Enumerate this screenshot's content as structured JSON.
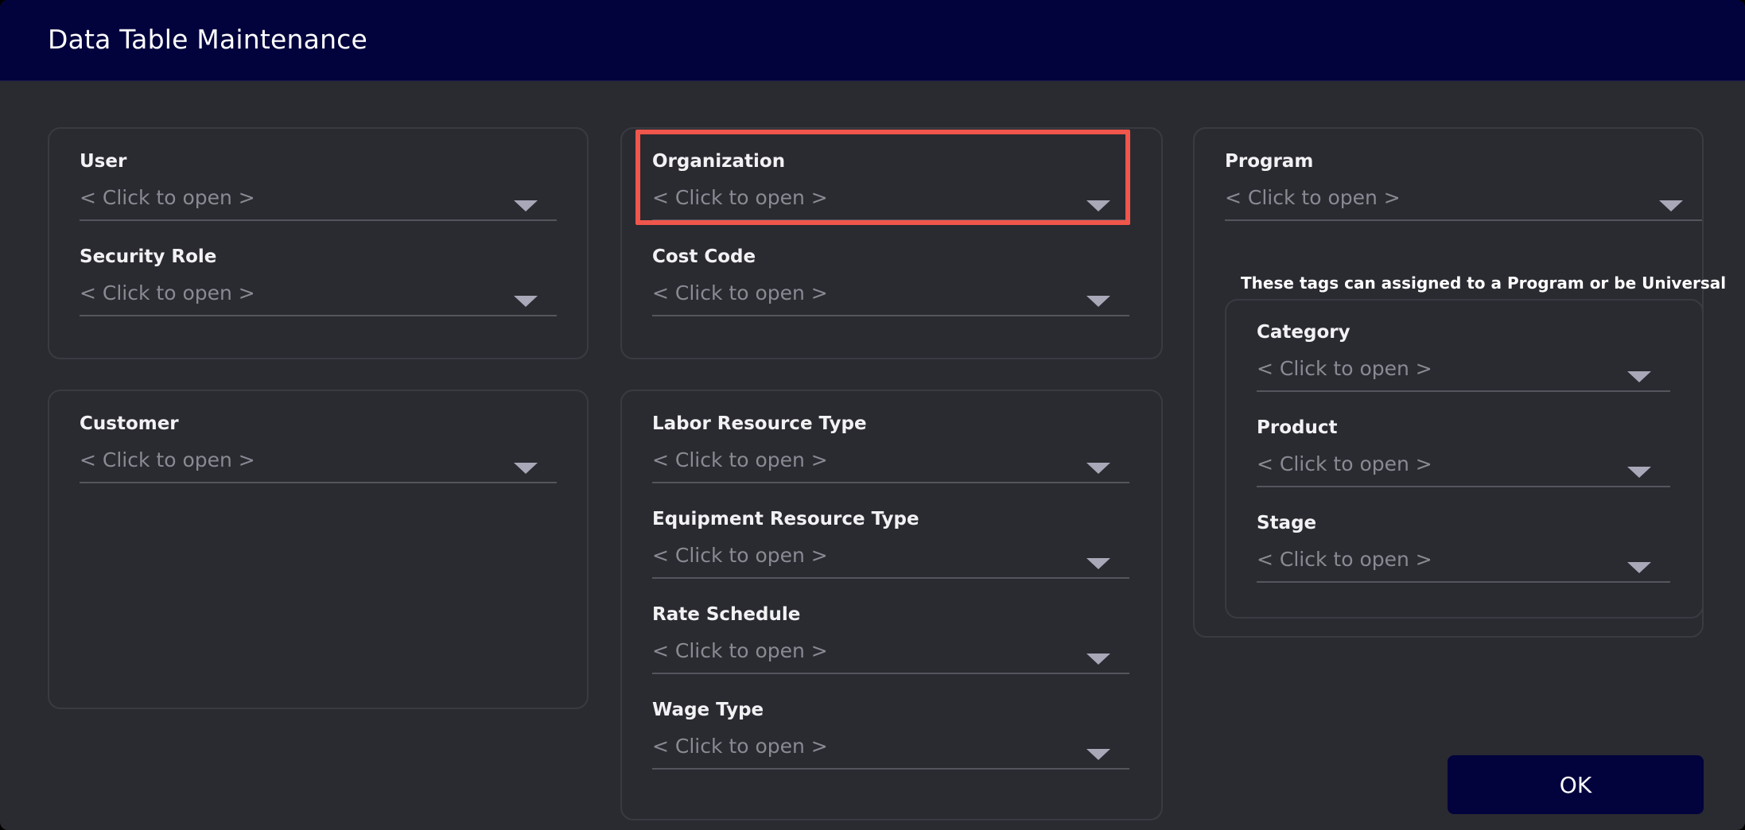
{
  "window": {
    "title": "Data Table Maintenance"
  },
  "placeholder": "< Click to open >",
  "fields": {
    "user": "User",
    "security_role": "Security Role",
    "customer": "Customer",
    "organization": "Organization",
    "cost_code": "Cost Code",
    "labor_resource_type": "Labor Resource Type",
    "equipment_resource_type": "Equipment Resource Type",
    "rate_schedule": "Rate Schedule",
    "wage_type": "Wage Type",
    "program": "Program",
    "category": "Category",
    "product": "Product",
    "stage": "Stage"
  },
  "tags_note": "These tags can assigned to a Program or be Universal",
  "buttons": {
    "ok": "OK"
  },
  "colors": {
    "titlebar": "#02023d",
    "background": "#2a2a31",
    "highlight": "#f0564b",
    "placeholder_text": "#8a8a94"
  }
}
